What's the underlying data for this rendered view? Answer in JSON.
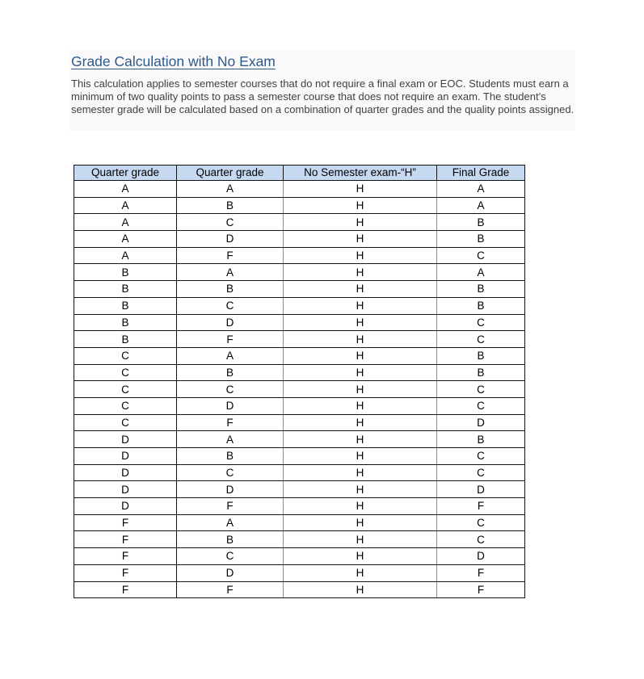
{
  "document": {
    "title": "Grade Calculation with No Exam",
    "description": "This calculation applies to semester courses that do not require a final exam or EOC. Students must earn a minimum of two quality points to pass a semester course that does not require an exam. The student’s semester grade will be calculated based on a combination of quarter grades and the quality points assigned."
  },
  "table": {
    "headers": [
      "Quarter grade",
      "Quarter grade",
      "No Semester exam-“H”",
      "Final Grade"
    ],
    "header_color": "#c6d9f1",
    "rows": [
      [
        "A",
        "A",
        "H",
        "A"
      ],
      [
        "A",
        "B",
        "H",
        "A"
      ],
      [
        "A",
        "C",
        "H",
        "B"
      ],
      [
        "A",
        "D",
        "H",
        "B"
      ],
      [
        "A",
        "F",
        "H",
        "C"
      ],
      [
        "B",
        "A",
        "H",
        "A"
      ],
      [
        "B",
        "B",
        "H",
        "B"
      ],
      [
        "B",
        "C",
        "H",
        "B"
      ],
      [
        "B",
        "D",
        "H",
        "C"
      ],
      [
        "B",
        "F",
        "H",
        "C"
      ],
      [
        "C",
        "A",
        "H",
        "B"
      ],
      [
        "C",
        "B",
        "H",
        "B"
      ],
      [
        "C",
        "C",
        "H",
        "C"
      ],
      [
        "C",
        "D",
        "H",
        "C"
      ],
      [
        "C",
        "F",
        "H",
        "D"
      ],
      [
        "D",
        "A",
        "H",
        "B"
      ],
      [
        "D",
        "B",
        "H",
        "C"
      ],
      [
        "D",
        "C",
        "H",
        "C"
      ],
      [
        "D",
        "D",
        "H",
        "D"
      ],
      [
        "D",
        "F",
        "H",
        "F"
      ],
      [
        "F",
        "A",
        "H",
        "C"
      ],
      [
        "F",
        "B",
        "H",
        "C"
      ],
      [
        "F",
        "C",
        "H",
        "D"
      ],
      [
        "F",
        "D",
        "H",
        "F"
      ],
      [
        "F",
        "F",
        "H",
        "F"
      ]
    ]
  }
}
